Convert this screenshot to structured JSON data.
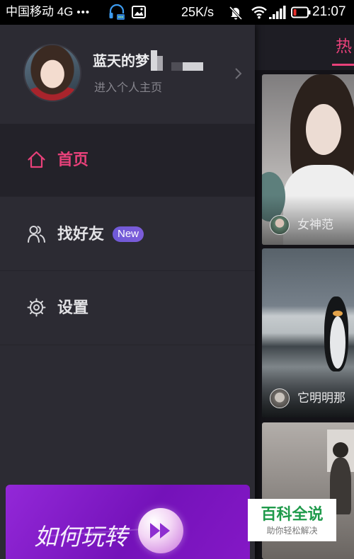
{
  "status_bar": {
    "carrier": "中国移动 4G",
    "dots": "•••",
    "net_speed": "25K/s",
    "time": "21:07",
    "icons": [
      "headset-notification-icon",
      "image-notification-icon",
      "mute-icon",
      "wifi-icon",
      "signal-icon",
      "battery-icon"
    ]
  },
  "drawer": {
    "profile": {
      "name": "蓝天的梦",
      "subtitle": "进入个人主页",
      "icon": "chevron-right-icon"
    },
    "menu": [
      {
        "label": "首页",
        "icon": "home-icon",
        "active": true
      },
      {
        "label": "找好友",
        "icon": "friends-icon",
        "badge": "New"
      },
      {
        "label": "设置",
        "icon": "settings-icon"
      }
    ],
    "banner": {
      "text": "如何玩转",
      "icon": "fast-forward-icon"
    }
  },
  "feed": {
    "tab": "热",
    "cards": [
      {
        "caption": "女神范"
      },
      {
        "caption": "它明明那"
      },
      {}
    ]
  },
  "watermark": {
    "title": "百科全说",
    "subtitle": "助你轻松解决"
  },
  "colors": {
    "accent": "#e8417a",
    "badge": "#7c5cd9",
    "drawer_bg": "#2c2b33",
    "active_row_bg": "#232229",
    "banner_start": "#9328d8",
    "banner_end": "#7412b9",
    "watermark_green": "#1f9a4b"
  }
}
